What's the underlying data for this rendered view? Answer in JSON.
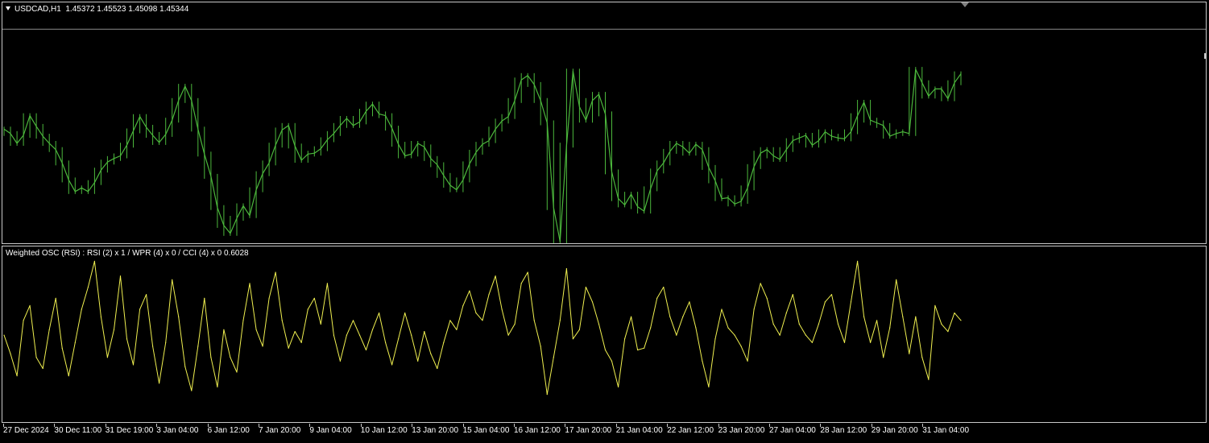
{
  "header": {
    "symbol": "USDCAD,H1",
    "ohlc": "1.45372 1.45523 1.45098 1.45344"
  },
  "indicator": {
    "label": "Weighted OSC (RSI) : RSI (2) x 1 / WPR (4) x 0 / CCI (4) x 0 0.6028"
  },
  "colors": {
    "background": "#000000",
    "price": "#4cb83c",
    "oscillator": "#f0f050",
    "border": "#c8c8c8",
    "bid_line": "#8c8c8c"
  },
  "time_axis": {
    "labels": [
      "27 Dec 2024",
      "30 Dec 11:00",
      "31 Dec 19:00",
      "3 Jan 04:00",
      "6 Jan 12:00",
      "7 Jan 20:00",
      "9 Jan 04:00",
      "10 Jan 12:00",
      "13 Jan 20:00",
      "15 Jan 04:00",
      "16 Jan 12:00",
      "17 Jan 20:00",
      "21 Jan 04:00",
      "22 Jan 12:00",
      "23 Jan 20:00",
      "27 Jan 04:00",
      "28 Jan 12:00",
      "29 Jan 20:00",
      "31 Jan 04:00"
    ]
  },
  "chart_data": [
    {
      "type": "line",
      "series": [
        {
          "name": "USDCAD,H1",
          "values": [
            1.4388,
            1.4383,
            1.4372,
            1.4381,
            1.4403,
            1.4391,
            1.438,
            1.4372,
            1.4365,
            1.435,
            1.4331,
            1.4318,
            1.4322,
            1.4318,
            1.4328,
            1.4342,
            1.4351,
            1.4355,
            1.4358,
            1.437,
            1.4386,
            1.4402,
            1.439,
            1.4381,
            1.4373,
            1.4382,
            1.4398,
            1.442,
            1.4436,
            1.442,
            1.4388,
            1.436,
            1.4335,
            1.43,
            1.428,
            1.4271,
            1.4288,
            1.4302,
            1.4291,
            1.432,
            1.4338,
            1.435,
            1.437,
            1.4387,
            1.4392,
            1.4369,
            1.4353,
            1.436,
            1.4361,
            1.4366,
            1.4376,
            1.4383,
            1.4392,
            1.44,
            1.4392,
            1.4396,
            1.4408,
            1.4416,
            1.4405,
            1.4403,
            1.4389,
            1.4371,
            1.4358,
            1.436,
            1.4372,
            1.4368,
            1.4355,
            1.4348,
            1.4336,
            1.4325,
            1.432,
            1.4331,
            1.4349,
            1.4362,
            1.4371,
            1.4375,
            1.4388,
            1.4397,
            1.4402,
            1.442,
            1.4443,
            1.4448,
            1.4438,
            1.442,
            1.4395,
            1.43,
            1.4262,
            1.437,
            1.4453,
            1.4413,
            1.4398,
            1.442,
            1.4427,
            1.4405,
            1.434,
            1.431,
            1.4303,
            1.4315,
            1.4301,
            1.4296,
            1.4321,
            1.4341,
            1.435,
            1.4363,
            1.4372,
            1.4368,
            1.4361,
            1.4371,
            1.4365,
            1.4345,
            1.433,
            1.431,
            1.4311,
            1.4304,
            1.4307,
            1.4322,
            1.4346,
            1.4361,
            1.4365,
            1.4358,
            1.4354,
            1.4365,
            1.4375,
            1.4378,
            1.4381,
            1.437,
            1.4375,
            1.4385,
            1.438,
            1.4378,
            1.4377,
            1.4385,
            1.4403,
            1.4418,
            1.4398,
            1.4395,
            1.4392,
            1.438,
            1.4383,
            1.4385,
            1.4383,
            1.4455,
            1.444,
            1.4425,
            1.4433,
            1.4433,
            1.4422,
            1.444,
            1.445
          ]
        }
      ],
      "x_labels": [
        "27 Dec 2024",
        "30 Dec 11:00",
        "31 Dec 19:00",
        "3 Jan 04:00",
        "6 Jan 12:00",
        "7 Jan 20:00",
        "9 Jan 04:00",
        "10 Jan 12:00",
        "13 Jan 20:00",
        "15 Jan 04:00",
        "16 Jan 12:00",
        "17 Jan 20:00",
        "21 Jan 04:00",
        "22 Jan 12:00",
        "23 Jan 20:00",
        "27 Jan 04:00",
        "28 Jan 12:00",
        "29 Jan 20:00",
        "31 Jan 04:00"
      ],
      "bid_line": 1.45,
      "ylim": [
        1.426,
        1.453
      ],
      "grid": false,
      "legend": "none"
    },
    {
      "type": "line",
      "series": [
        {
          "name": "Weighted OSC (RSI)",
          "values": [
            0.52,
            0.42,
            0.3,
            0.6,
            0.68,
            0.4,
            0.34,
            0.55,
            0.72,
            0.45,
            0.3,
            0.48,
            0.66,
            0.78,
            0.92,
            0.62,
            0.4,
            0.55,
            0.84,
            0.5,
            0.36,
            0.66,
            0.74,
            0.46,
            0.26,
            0.48,
            0.82,
            0.62,
            0.35,
            0.22,
            0.46,
            0.72,
            0.4,
            0.24,
            0.55,
            0.4,
            0.32,
            0.6,
            0.8,
            0.55,
            0.46,
            0.72,
            0.86,
            0.6,
            0.45,
            0.54,
            0.48,
            0.66,
            0.72,
            0.58,
            0.8,
            0.52,
            0.38,
            0.52,
            0.6,
            0.52,
            0.44,
            0.55,
            0.64,
            0.48,
            0.36,
            0.5,
            0.64,
            0.52,
            0.38,
            0.54,
            0.42,
            0.34,
            0.48,
            0.6,
            0.55,
            0.68,
            0.76,
            0.64,
            0.6,
            0.74,
            0.84,
            0.66,
            0.52,
            0.58,
            0.8,
            0.86,
            0.6,
            0.46,
            0.2,
            0.4,
            0.6,
            0.88,
            0.5,
            0.55,
            0.78,
            0.7,
            0.58,
            0.44,
            0.38,
            0.24,
            0.5,
            0.62,
            0.44,
            0.45,
            0.56,
            0.72,
            0.78,
            0.62,
            0.52,
            0.62,
            0.7,
            0.56,
            0.38,
            0.24,
            0.5,
            0.66,
            0.56,
            0.52,
            0.46,
            0.38,
            0.66,
            0.8,
            0.72,
            0.58,
            0.52,
            0.64,
            0.74,
            0.58,
            0.52,
            0.48,
            0.58,
            0.7,
            0.74,
            0.58,
            0.48,
            0.7,
            0.92,
            0.62,
            0.48,
            0.6,
            0.4,
            0.56,
            0.82,
            0.62,
            0.42,
            0.62,
            0.4,
            0.28,
            0.68,
            0.58,
            0.54,
            0.64,
            0.6
          ]
        }
      ],
      "x_labels": [
        "27 Dec 2024",
        "30 Dec 11:00",
        "31 Dec 19:00",
        "3 Jan 04:00",
        "6 Jan 12:00",
        "7 Jan 20:00",
        "9 Jan 04:00",
        "10 Jan 12:00",
        "13 Jan 20:00",
        "15 Jan 04:00",
        "16 Jan 12:00",
        "17 Jan 20:00",
        "21 Jan 04:00",
        "22 Jan 12:00",
        "23 Jan 20:00",
        "27 Jan 04:00",
        "28 Jan 12:00",
        "29 Jan 20:00",
        "31 Jan 04:00"
      ],
      "ylim": [
        0.05,
        1.0
      ],
      "grid": false,
      "legend": "none"
    }
  ]
}
